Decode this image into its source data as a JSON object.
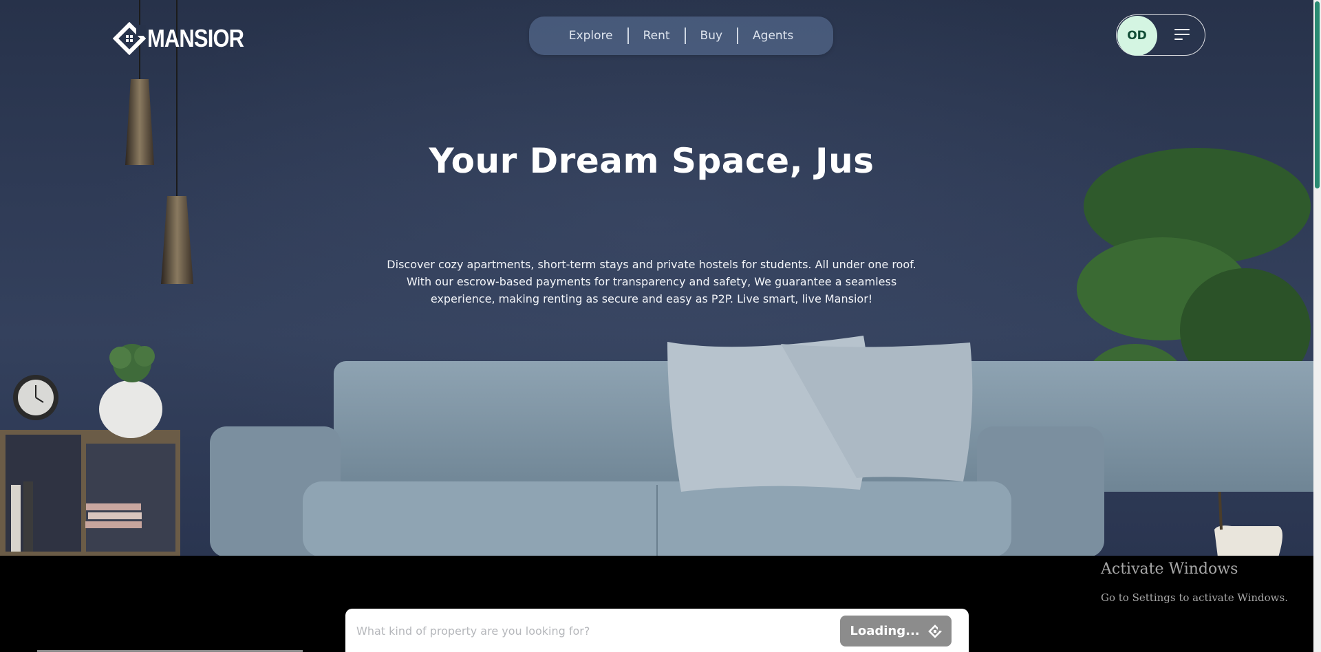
{
  "brand": {
    "name": "MANSIOR"
  },
  "nav": {
    "items": [
      "Explore",
      "Rent",
      "Buy",
      "Agents"
    ]
  },
  "profile": {
    "initials": "OD"
  },
  "hero": {
    "headline": "Your Dream Space, Jus",
    "description": "Discover cozy apartments, short-term stays and private hostels for students. All under one roof. With our escrow-based payments for transparency and safety, We guarantee a seamless experience, making renting as secure and easy as P2P. Live smart, live Mansior!"
  },
  "search": {
    "placeholder": "What kind of property are you looking for?",
    "button_label": "Loading..."
  },
  "os_watermark": {
    "title": "Activate Windows",
    "subtitle": "Go to Settings to activate Windows."
  },
  "colors": {
    "accent": "#d4f5e2",
    "accent_text": "#114d36",
    "nav_bg": "#4e6284",
    "button_disabled": "#8c8c8c",
    "scrollbar_thumb": "#2a8a72"
  }
}
